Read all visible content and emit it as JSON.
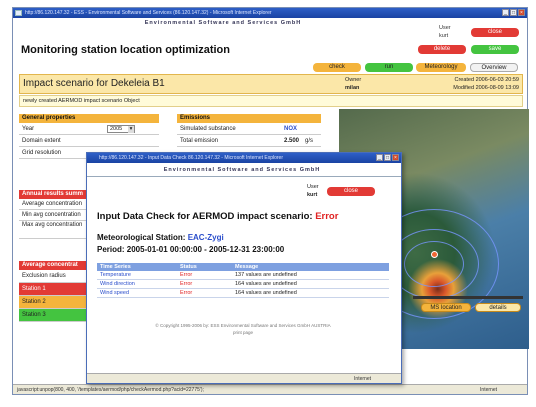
{
  "browser": {
    "title": "http://86.120.147.32 - ESS - Environmental Software and Services (86.120.147.32) - Microsoft Internet Explorer",
    "status_text": "javascript:unpop(800, 400, '/templates/aermod/php/checkAermod.php?acid=22775');",
    "zone": "Internet"
  },
  "header": {
    "brand": "Environmental Software and Services GmbH",
    "page_title": "Monitoring station location optimization",
    "user_label": "User",
    "user_name": "kurt",
    "close": "close",
    "delete": "delete",
    "save": "save",
    "tabs": [
      "check",
      "run",
      "Meteorology",
      "Overview"
    ]
  },
  "scenario": {
    "title": "Impact scenario for Dekeleia B1",
    "owner_label": "Owner",
    "owner": "milan",
    "created": "Created 2006-06-03 20:59",
    "modified": "Modified 2006-08-09 13:09",
    "description": "newly created AERMOD impact scenario Object"
  },
  "general": {
    "header": "General properties",
    "year_label": "Year",
    "year_value": "2005",
    "domain_extent": "Domain extent",
    "grid_resolution": "Grid resolution"
  },
  "emissions": {
    "header": "Emissions",
    "substance_label": "Simulated substance",
    "substance_value": "NOX",
    "total_label": "Total emission",
    "total_value": "2.500",
    "total_unit": "g/s"
  },
  "annual": {
    "header": "Annual results summ",
    "rows": [
      "Average concentration",
      "Min avg concentration",
      "Max avg concentration"
    ]
  },
  "average": {
    "header": "Average concentrat",
    "exclusion": "Exclusion radius",
    "stations": [
      "Station 1",
      "Station 2",
      "Station 3"
    ]
  },
  "map": {
    "ms_location": "MS location",
    "details": "details"
  },
  "dialog": {
    "title": "http://86.120.147.32 - Input Data Check 86.120.147.32 - Microsoft Internet Explorer",
    "brand": "Environmental Software and Services GmbH",
    "user_label": "User",
    "user_name": "kurt",
    "close": "close",
    "heading_prefix": "Input Data Check for AERMOD impact scenario:",
    "heading_status": "Error",
    "station_label": "Meteorological Station:",
    "station_value": "EAC-Zygi",
    "period": "Period: 2005-01-01 00:00:00 - 2005-12-31 23:00:00",
    "columns": [
      "Time Series",
      "Status",
      "Message"
    ],
    "rows": [
      {
        "series": "Temperature",
        "status": "Error",
        "message": "137 values are undefined"
      },
      {
        "series": "Wind direction",
        "status": "Error",
        "message": "164 values are undefined"
      },
      {
        "series": "Wind speed",
        "status": "Error",
        "message": "164 values are undefined"
      }
    ],
    "footer": "© Copyright 1995-2006 by: ESS Environmental Software and Services GmbH AUSTRIA",
    "print": "print page",
    "zone": "Internet"
  },
  "colors": {
    "accent_blue": "#2a4dcb",
    "error_red": "#e02222",
    "orange": "#f4b43c",
    "green": "#44c440",
    "red": "#e23a35"
  }
}
